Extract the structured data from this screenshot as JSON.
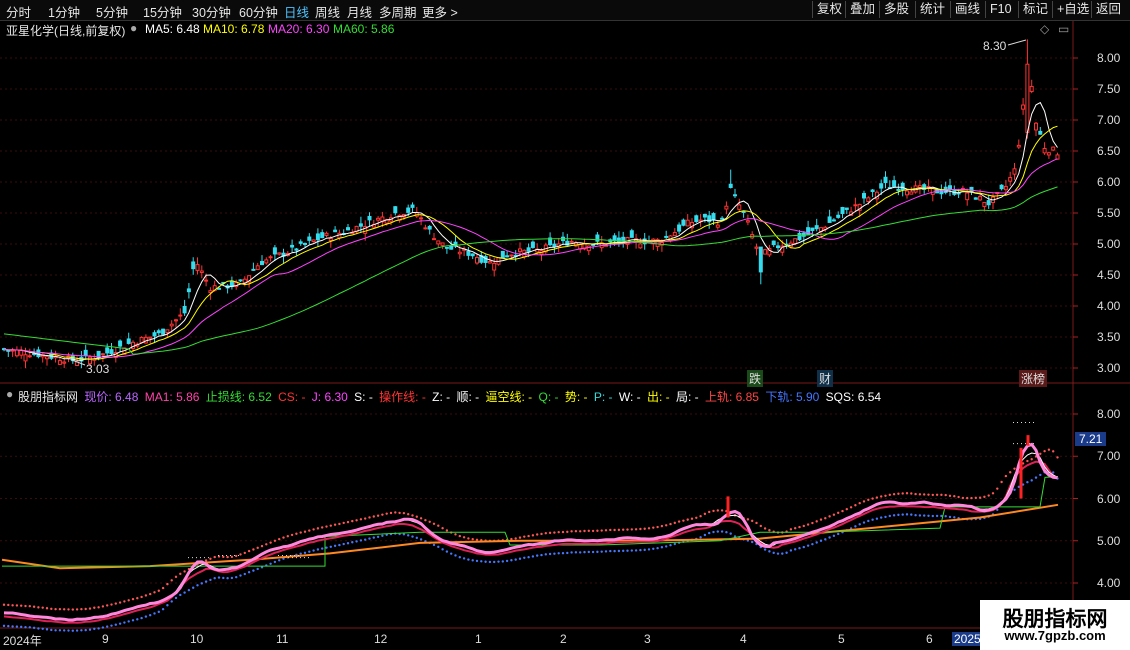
{
  "toolbar": {
    "periods": [
      "分时",
      "1分钟",
      "5分钟",
      "15分钟",
      "30分钟",
      "60分钟",
      "日线",
      "周线",
      "月线",
      "多周期",
      "更多 >"
    ],
    "active_period": "日线",
    "right_buttons": [
      "复权",
      "叠加",
      "多股",
      "统计",
      "画线",
      "F10",
      "标记",
      "+自选",
      "返回"
    ]
  },
  "main_panel": {
    "title": "亚星化学(日线,前复权)",
    "indicators": [
      {
        "label": "MA5: 6.48",
        "color": "#ffffff"
      },
      {
        "label": "MA10: 6.78",
        "color": "#ffff00"
      },
      {
        "label": "MA20: 6.30",
        "color": "#ff44ff"
      },
      {
        "label": "MA60: 5.86",
        "color": "#33dd33"
      }
    ],
    "high_label": "8.30",
    "low_label": "3.03",
    "markers": [
      {
        "text": "跌",
        "color": "#33dd33"
      },
      {
        "text": "财",
        "color": "#4fc3ff"
      },
      {
        "text": "涨榜",
        "color": "#ff6666"
      }
    ],
    "y_ticks": [
      "8.00",
      "7.50",
      "7.00",
      "6.50",
      "6.00",
      "5.50",
      "5.00",
      "4.50",
      "4.00",
      "3.50",
      "3.00"
    ]
  },
  "sub_panel": {
    "title": "股朋指标网",
    "indicators": [
      {
        "label": "现价: 6.48",
        "color": "#bb66ff"
      },
      {
        "label": "MA1: 5.86",
        "color": "#ff44aa"
      },
      {
        "label": "止损线: 6.52",
        "color": "#33dd33"
      },
      {
        "label": "CS: -",
        "color": "#ff3333"
      },
      {
        "label": "J: 6.30",
        "color": "#ff44ff"
      },
      {
        "label": "S: -",
        "color": "#ffffff"
      },
      {
        "label": "操作线: -",
        "color": "#ff3333"
      },
      {
        "label": "Z: -",
        "color": "#ffffff"
      },
      {
        "label": "顺: -",
        "color": "#ffffff"
      },
      {
        "label": "逼空线: -",
        "color": "#ffff00"
      },
      {
        "label": "Q: -",
        "color": "#33dd33"
      },
      {
        "label": "势: -",
        "color": "#ffff00"
      },
      {
        "label": "P: -",
        "color": "#33dddd"
      },
      {
        "label": "W: -",
        "color": "#ffffff"
      },
      {
        "label": "出: -",
        "color": "#ffff00"
      },
      {
        "label": "局: -",
        "color": "#ffffff"
      },
      {
        "label": "上轨: 6.85",
        "color": "#ff4444"
      },
      {
        "label": "下轨: 5.90",
        "color": "#4477ff"
      },
      {
        "label": "SQS: 6.54",
        "color": "#ffffff"
      }
    ],
    "current_value": "7.21",
    "y_ticks": [
      "8.00",
      "7.00",
      "6.00",
      "5.00",
      "4.00"
    ]
  },
  "x_axis": {
    "labels": [
      "2024年",
      "9",
      "10",
      "11",
      "12",
      "1",
      "2",
      "3",
      "4",
      "5",
      "6",
      "2025/"
    ]
  },
  "chart_data": {
    "type": "candlestick",
    "title": "亚星化学(日线,前复权)",
    "ylim": [
      2.9,
      8.3
    ],
    "high": 8.3,
    "low": 3.03,
    "x_labels": [
      "2024年",
      "9",
      "10",
      "11",
      "12",
      "1",
      "2",
      "3",
      "4",
      "5",
      "6",
      "2025/"
    ],
    "close_approx": [
      3.3,
      3.2,
      3.15,
      3.2,
      3.6,
      4.2,
      4.3,
      4.6,
      4.9,
      5.2,
      5.4,
      5.6,
      5.4,
      4.8,
      4.5,
      4.8,
      4.9,
      5.0,
      5.0,
      5.1,
      5.4,
      5.3,
      4.8,
      5.1,
      5.3,
      5.6,
      5.9,
      5.9,
      5.8,
      5.7,
      5.9,
      7.2,
      6.7,
      6.48
    ],
    "series": [
      {
        "name": "MA5",
        "last": 6.48
      },
      {
        "name": "MA10",
        "last": 6.78
      },
      {
        "name": "MA20",
        "last": 6.3
      },
      {
        "name": "MA60",
        "last": 5.86
      }
    ]
  }
}
